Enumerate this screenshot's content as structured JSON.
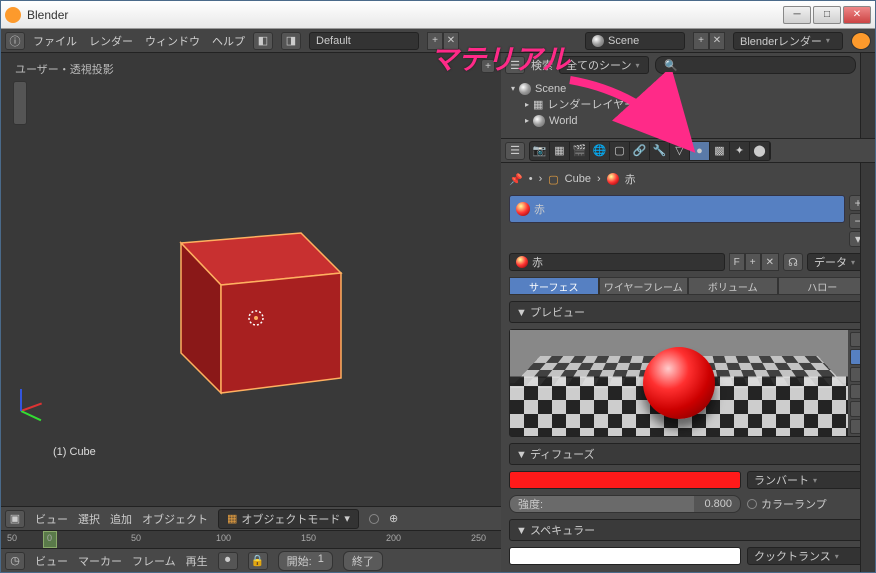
{
  "window": {
    "title": "Blender"
  },
  "topmenu": {
    "file": "ファイル",
    "render": "レンダー",
    "window": "ウィンドウ",
    "help": "ヘルプ",
    "layout": "Default",
    "scene": "Scene",
    "engine": "Blenderレンダー"
  },
  "viewport": {
    "label": "ユーザー・透視投影",
    "object_label": "(1) Cube"
  },
  "vp_header": {
    "view": "ビュー",
    "select": "選択",
    "add": "追加",
    "object": "オブジェクト",
    "mode": "オブジェクトモード"
  },
  "timeline": {
    "t0": "50",
    "t1": "0",
    "t2": "50",
    "t3": "100",
    "t4": "150",
    "t5": "200",
    "t6": "250"
  },
  "tl_header": {
    "view": "ビュー",
    "marker": "マーカー",
    "frame": "フレーム",
    "play": "再生",
    "start_label": "開始:",
    "start_val": "1",
    "end_label": "終了"
  },
  "outliner": {
    "search_label": "検索",
    "filter": "全てのシーン",
    "scene": "Scene",
    "layers": "レンダーレイヤー",
    "world": "World"
  },
  "crumb": {
    "obj": "Cube",
    "mat": "赤"
  },
  "material": {
    "name": "赤",
    "f": "F",
    "link": "データ"
  },
  "mode_tabs": {
    "surface": "サーフェス",
    "wire": "ワイヤーフレーム",
    "volume": "ボリューム",
    "halo": "ハロー"
  },
  "panels": {
    "preview": "▼ プレビュー",
    "diffuse": "▼ ディフューズ",
    "specular": "▼ スペキュラー"
  },
  "diffuse": {
    "shader": "ランバート",
    "intensity_label": "強度:",
    "intensity_val": "0.800",
    "ramp": "カラーランプ"
  },
  "specular": {
    "shader": "クックトランス"
  },
  "annotation": {
    "text": "マテリアル"
  },
  "chart_data": null
}
